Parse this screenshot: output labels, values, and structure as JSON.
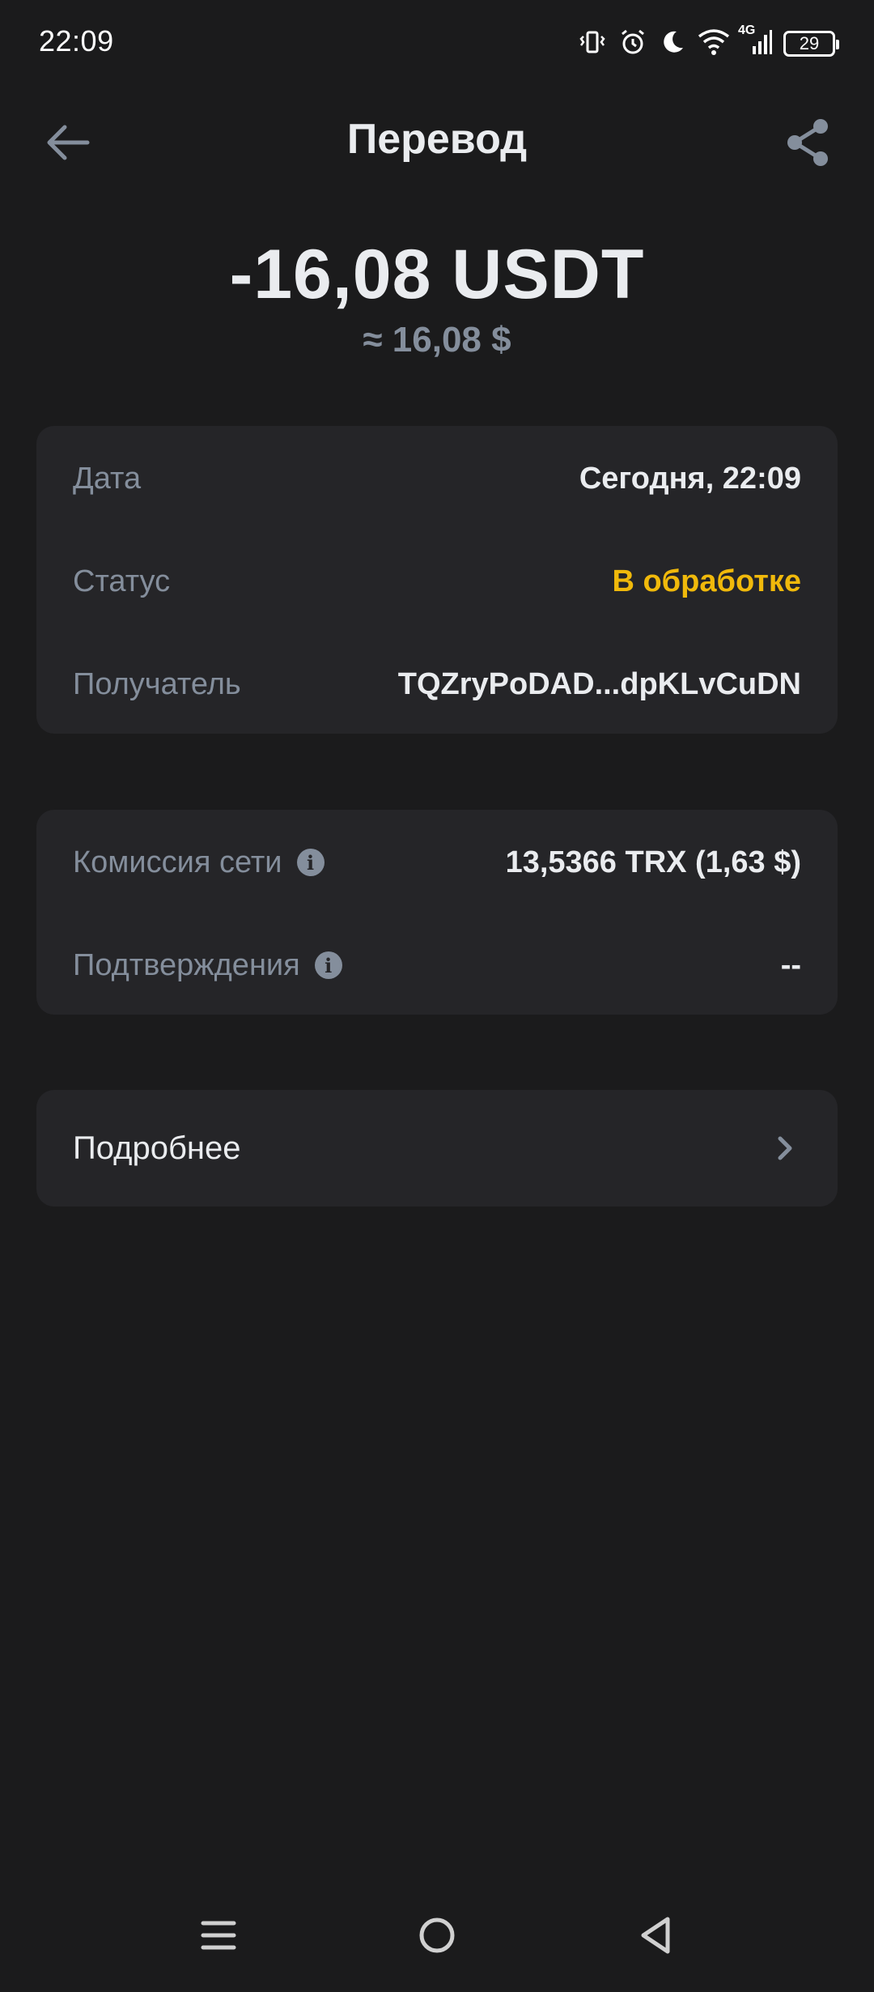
{
  "status_bar": {
    "time": "22:09",
    "network": "4G",
    "battery": "29"
  },
  "header": {
    "title": "Перевод"
  },
  "amount": {
    "crypto": "-16,08 USDT",
    "fiat": "≈ 16,08 $"
  },
  "details": [
    {
      "label": "Дата",
      "value": "Сегодня, 22:09"
    },
    {
      "label": "Статус",
      "value": "В обработке"
    },
    {
      "label": "Получатель",
      "value": "TQZryPoDAD...dpKLvCuDN"
    }
  ],
  "fees": [
    {
      "label": "Комиссия сети",
      "value": "13,5366 TRX (1,63 $)"
    },
    {
      "label": "Подтверждения",
      "value": "--"
    }
  ],
  "more": {
    "label": "Подробнее"
  },
  "colors": {
    "background": "#1b1b1c",
    "card": "#252528",
    "pending": "#f0b90b",
    "muted": "#848e9c"
  }
}
